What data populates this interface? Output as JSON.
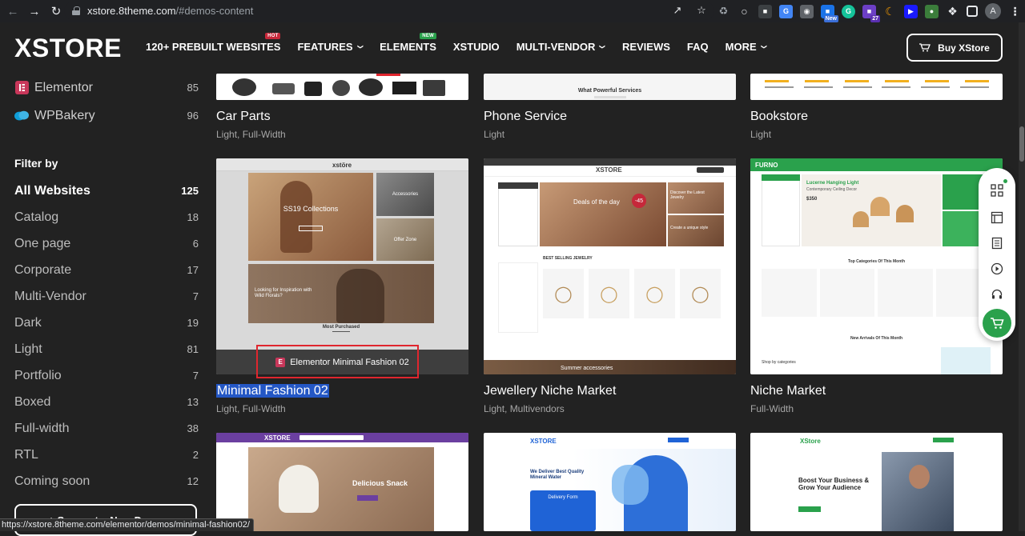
{
  "browser": {
    "url_host": "xstore.8theme.com",
    "url_path": "/#demos-content",
    "ext_new_badge": "New",
    "ext_count_badge": "27",
    "profile_initial": "A"
  },
  "header": {
    "logo": "XSTORE",
    "nav": [
      {
        "label": "120+ PREBUILT WEBSITES",
        "badge": "HOT",
        "dropdown": false
      },
      {
        "label": "FEATURES",
        "badge": "",
        "dropdown": true
      },
      {
        "label": "ELEMENTS",
        "badge": "NEW",
        "dropdown": false
      },
      {
        "label": "XSTUDIO",
        "badge": "",
        "dropdown": false
      },
      {
        "label": "MULTI-VENDOR",
        "badge": "",
        "dropdown": true
      },
      {
        "label": "REVIEWS",
        "badge": "",
        "dropdown": false
      },
      {
        "label": "FAQ",
        "badge": "",
        "dropdown": false
      },
      {
        "label": "MORE",
        "badge": "",
        "dropdown": true
      }
    ],
    "buy_label": "Buy XStore"
  },
  "sidebar": {
    "builders": [
      {
        "label": "Elementor",
        "count": "85"
      },
      {
        "label": "WPBakery",
        "count": "96"
      }
    ],
    "filter_title": "Filter by",
    "filters": [
      {
        "label": "All Websites",
        "count": "125",
        "active": true
      },
      {
        "label": "Catalog",
        "count": "18"
      },
      {
        "label": "One page",
        "count": "6"
      },
      {
        "label": "Corporate",
        "count": "17"
      },
      {
        "label": "Multi-Vendor",
        "count": "7"
      },
      {
        "label": "Dark",
        "count": "19"
      },
      {
        "label": "Light",
        "count": "81"
      },
      {
        "label": "Portfolio",
        "count": "7"
      },
      {
        "label": "Boxed",
        "count": "13"
      },
      {
        "label": "Full-width",
        "count": "38"
      },
      {
        "label": "RTL",
        "count": "2"
      },
      {
        "label": "Coming soon",
        "count": "12"
      }
    ],
    "suggest_label": "+ Suggest a New Demo"
  },
  "demos": {
    "row1": [
      {
        "title": "Car Parts",
        "tags": "Light, Full-Width"
      },
      {
        "title": "Phone Service",
        "tags": "Light",
        "thumb_text": "What Powerful Services"
      },
      {
        "title": "Bookstore",
        "tags": "Light"
      }
    ],
    "row2": [
      {
        "title": "Minimal Fashion 02",
        "tags": "Light, Full-Width",
        "overlay": "Elementor Minimal Fashion 02",
        "logo": "xstöre",
        "hero": "SS19 Collections",
        "side1": "Accessories",
        "side2": "Offer Zone",
        "mid": "Looking for Inspiration with Wild Florals?",
        "bottom": "Most Purchased"
      },
      {
        "title": "Jewellery Niche Market",
        "tags": "Light, Multivendors",
        "logo": "XSTORE",
        "hero": "Deals of the day",
        "sale": "-45",
        "side1": "Discover the Latest Jewelry",
        "side2": "Create a unique style",
        "section": "BEST SELLING JEWELRY",
        "bottom": "Summer accessories"
      },
      {
        "title": "Niche Market",
        "tags": "Full-Width",
        "logo": "FURNO",
        "hero": "Lucerne Hanging Light",
        "hero_sub": "Contemporary Ceiling Decor",
        "price": "$350",
        "section": "Top Categories Of This Month",
        "section2": "New Arrivals Of This Month",
        "bottom": "Shop by categories"
      }
    ],
    "row3": [
      {
        "logo": "XSTORE",
        "hero": "Delicious Snack"
      },
      {
        "logo": "XSTORE",
        "hero": "We Deliver Best Quality Mineral Water",
        "form": "Delivery Form"
      },
      {
        "logo": "XStore",
        "hero": "Boost Your Business & Grow Your Audience"
      }
    ]
  },
  "status_url": "https://xstore.8theme.com/elementor/demos/minimal-fashion02/"
}
